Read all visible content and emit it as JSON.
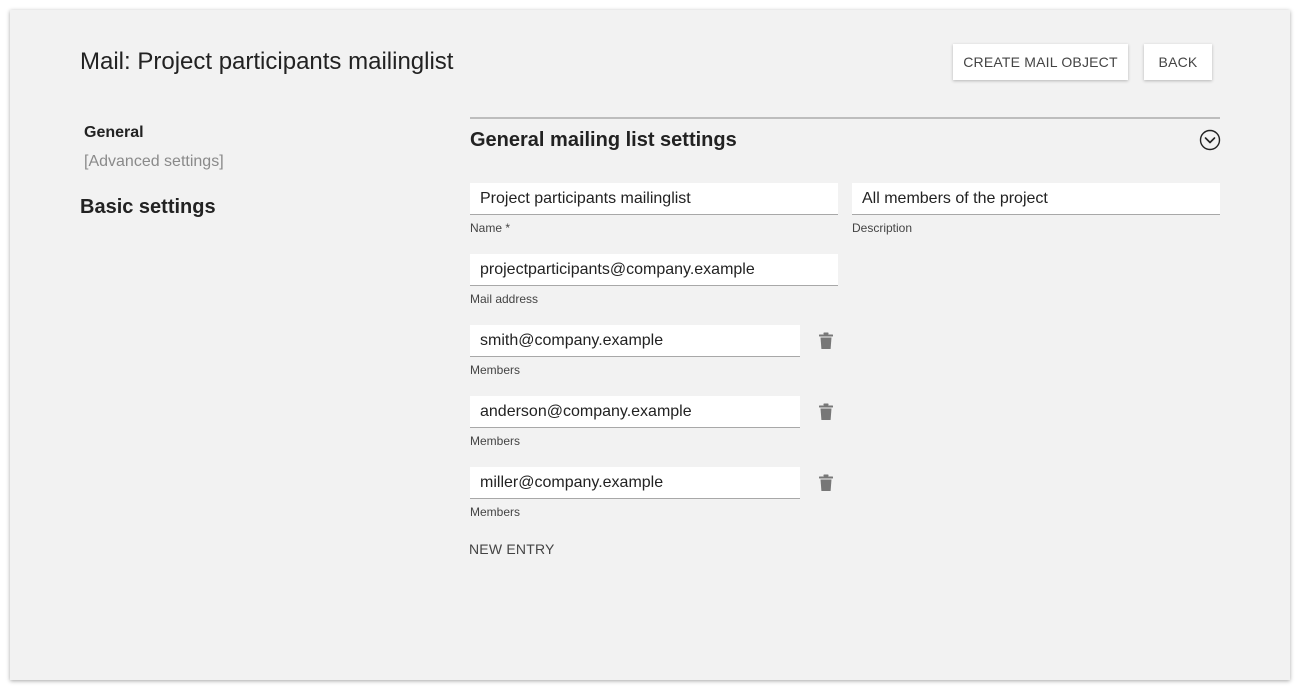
{
  "header": {
    "title": "Mail: Project participants mailinglist",
    "create_label": "CREATE MAIL OBJECT",
    "back_label": "BACK"
  },
  "sidebar": {
    "items": [
      {
        "label": "General",
        "active": true
      },
      {
        "label": "[Advanced settings]",
        "active": false
      }
    ],
    "section_title": "Basic settings"
  },
  "panel": {
    "title": "General mailing list settings",
    "collapse_icon": "chevron-circle-icon",
    "fields": {
      "name": {
        "value": "Project participants mailinglist",
        "label": "Name *"
      },
      "description": {
        "value": "All members of the project",
        "label": "Description"
      },
      "mail_address": {
        "value": "projectparticipants@company.example",
        "label": "Mail address"
      }
    },
    "members": [
      {
        "value": "smith@company.example",
        "label": "Members"
      },
      {
        "value": "anderson@company.example",
        "label": "Members"
      },
      {
        "value": "miller@company.example",
        "label": "Members"
      }
    ],
    "new_entry_label": "NEW ENTRY"
  },
  "colors": {
    "background": "#f2f2f2",
    "field_background": "#ffffff",
    "muted_text": "#8a8a8a",
    "icon": "#777777"
  }
}
